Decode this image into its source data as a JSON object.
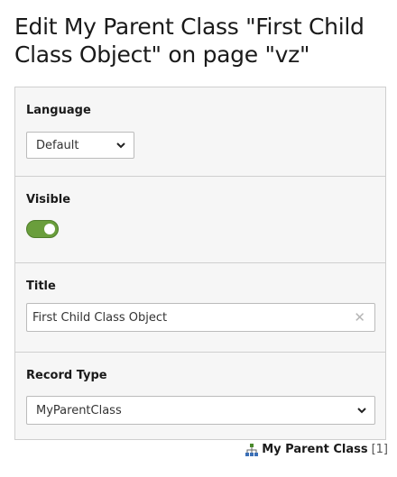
{
  "header": {
    "title": "Edit My Parent Class \"First Child Class Object\" on page \"vz\""
  },
  "form": {
    "language": {
      "label": "Language",
      "value": "Default"
    },
    "visible": {
      "label": "Visible",
      "checked": true
    },
    "title": {
      "label": "Title",
      "value": "First Child Class Object"
    },
    "record_type": {
      "label": "Record Type",
      "value": "MyParentClass"
    }
  },
  "footer": {
    "record_name": "My Parent Class",
    "record_uid": "[1]"
  },
  "colors": {
    "toggle_on": "#6a9e3c",
    "panel_bg": "#f6f6f6",
    "border": "#cfcfcf"
  }
}
